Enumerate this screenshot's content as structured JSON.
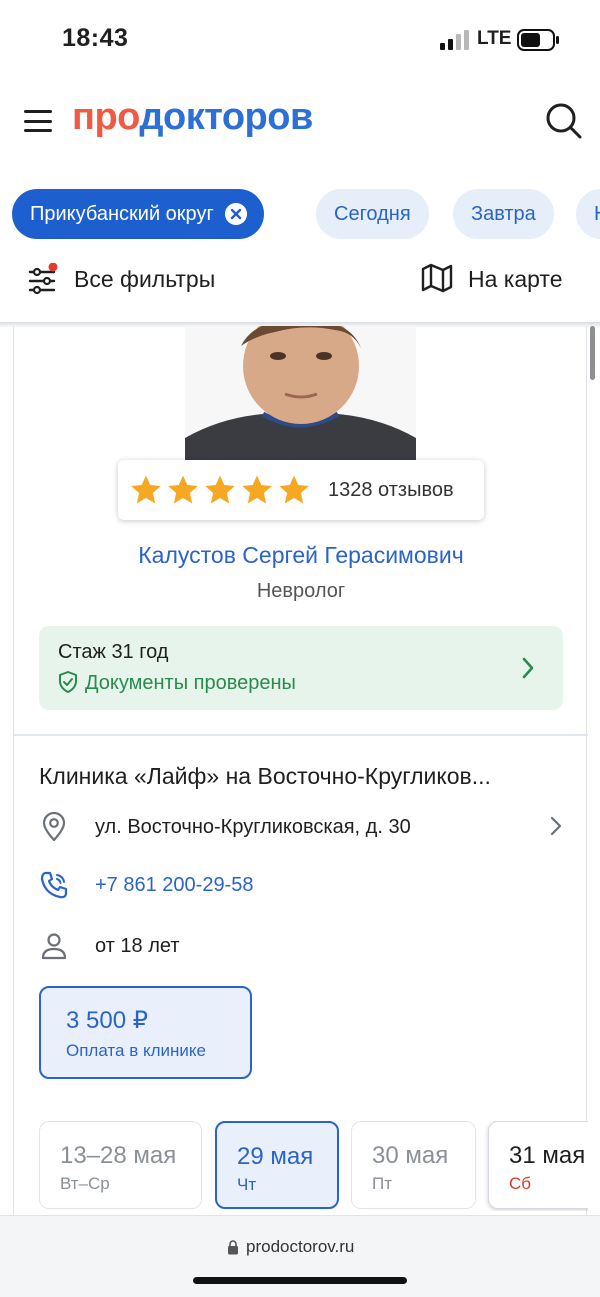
{
  "status": {
    "time": "18:43",
    "network": "LTE"
  },
  "header": {
    "logo_part1": "про",
    "logo_part2": "докторов"
  },
  "chips": [
    {
      "label": "Прикубанский округ",
      "active": true
    },
    {
      "label": "Сегодня"
    },
    {
      "label": "Завтра"
    },
    {
      "label": "Н"
    }
  ],
  "filters": {
    "all_filters": "Все фильтры",
    "on_map": "На карте"
  },
  "doctor": {
    "rating_stars": 5,
    "reviews": "1328 отзывов",
    "name": "Калустов Сергей Герасимович",
    "specialty": "Невролог",
    "experience": "Стаж 31 год",
    "documents": "Документы проверены"
  },
  "clinic": {
    "name": "Клиника «Лайф» на Восточно-Кругликов...",
    "address": "ул. Восточно-Кругликовская, д. 30",
    "phone": "+7 861 200-29-58",
    "age": "от 18 лет"
  },
  "price": {
    "amount": "3 500 ₽",
    "payment": "Оплата в клинике"
  },
  "dates": [
    {
      "date": "13–28 мая",
      "weekday": "Вт–Ср",
      "state": "disabled"
    },
    {
      "date": "29 мая",
      "weekday": "Чт",
      "state": "selected"
    },
    {
      "date": "30 мая",
      "weekday": "Пт",
      "state": "disabled"
    },
    {
      "date": "31 мая",
      "weekday": "Сб",
      "state": "available"
    }
  ],
  "browser": {
    "url": "prodoctorov.ru"
  },
  "colors": {
    "brand_red": "#ef5a45",
    "brand_blue": "#2a64c8",
    "star": "#f7a823",
    "success": "#2b8a4f"
  }
}
